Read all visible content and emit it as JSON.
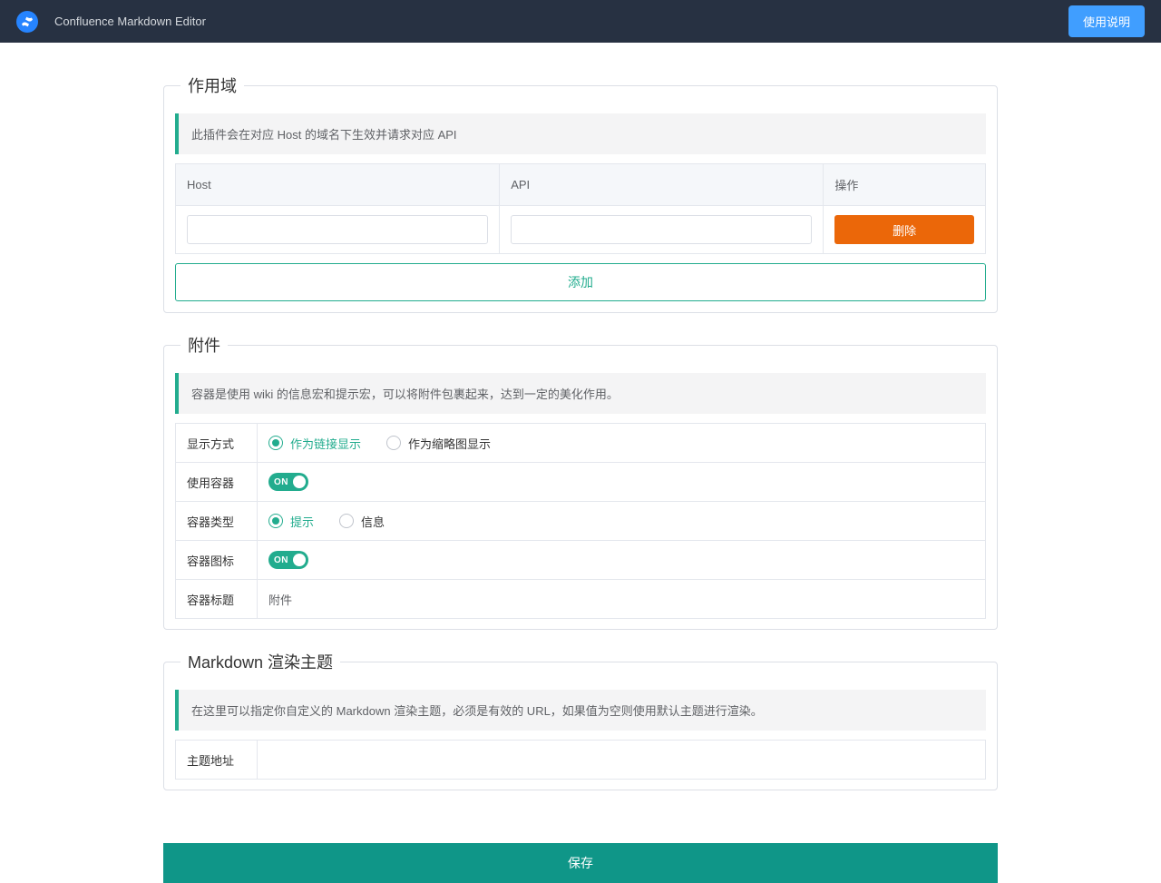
{
  "header": {
    "title": "Confluence Markdown Editor",
    "help_btn": "使用说明"
  },
  "scope": {
    "legend": "作用域",
    "tip": "此插件会在对应 Host 的域名下生效并请求对应 API",
    "cols": {
      "host": "Host",
      "api": "API",
      "action": "操作"
    },
    "rows": [
      {
        "host": "",
        "api": ""
      }
    ],
    "delete_btn": "删除",
    "add_btn": "添加"
  },
  "attach": {
    "legend": "附件",
    "tip": "容器是使用 wiki 的信息宏和提示宏，可以将附件包裹起来，达到一定的美化作用。",
    "display_mode": {
      "label": "显示方式",
      "opt1": "作为链接显示",
      "opt2": "作为缩略图显示",
      "selected": 1
    },
    "use_container": {
      "label": "使用容器",
      "on": "ON"
    },
    "container_type": {
      "label": "容器类型",
      "opt1": "提示",
      "opt2": "信息",
      "selected": 1
    },
    "container_icon": {
      "label": "容器图标",
      "on": "ON"
    },
    "container_title": {
      "label": "容器标题",
      "value": "附件"
    }
  },
  "theme": {
    "legend": "Markdown 渲染主题",
    "tip": "在这里可以指定你自定义的 Markdown 渲染主题，必须是有效的 URL，如果值为空则使用默认主题进行渲染。",
    "url_label": "主题地址",
    "url_value": ""
  },
  "save_btn": "保存"
}
